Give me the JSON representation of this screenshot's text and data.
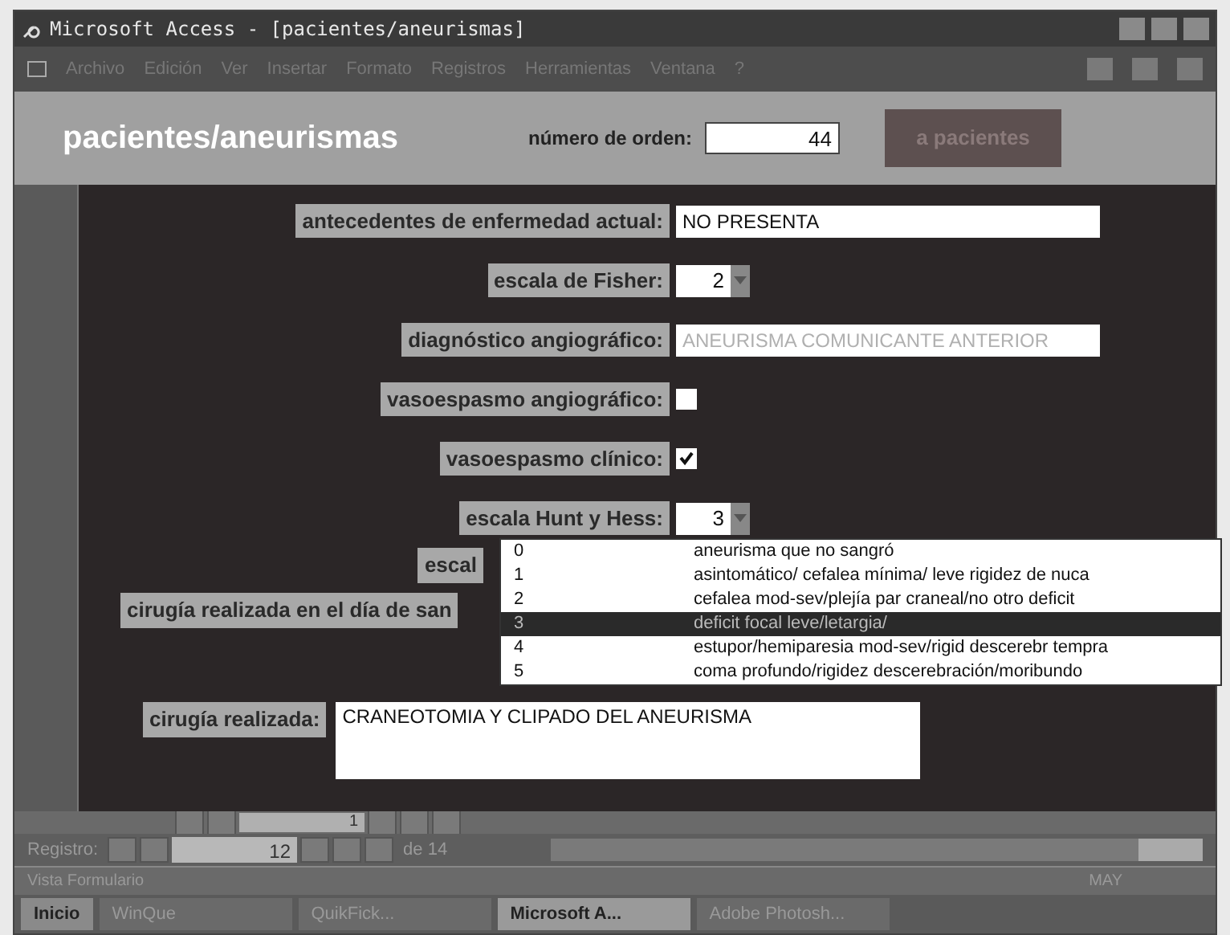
{
  "window": {
    "title": "Microsoft Access - [pacientes/aneurismas]"
  },
  "menu": [
    "Archivo",
    "Edición",
    "Ver",
    "Insertar",
    "Formato",
    "Registros",
    "Herramientas",
    "Ventana",
    "?"
  ],
  "form": {
    "title": "pacientes/aneurismas",
    "order_label": "número de orden:",
    "order_value": "44",
    "button": "a pacientes"
  },
  "fields": [
    {
      "kind": "text",
      "label": "antecedentes de enfermedad actual:",
      "value": "NO PRESENTA",
      "dim": false
    },
    {
      "kind": "combo",
      "label": "escala de Fisher:",
      "value": "2"
    },
    {
      "kind": "text",
      "label": "diagnóstico angiográfico:",
      "value": "ANEURISMA COMUNICANTE ANTERIOR",
      "dim": true
    },
    {
      "kind": "check",
      "label": "vasoespasmo angiográfico:",
      "checked": false
    },
    {
      "kind": "check",
      "label": "vasoespasmo clínico:",
      "checked": true
    },
    {
      "kind": "combo",
      "label": "escala Hunt y Hess:",
      "value": "3"
    },
    {
      "kind": "hidden",
      "label": "escal"
    },
    {
      "kind": "hidden",
      "label": "cirugía realizada en el día de san"
    }
  ],
  "dropdown": [
    {
      "code": "0",
      "text": "aneurisma que no sangró",
      "selected": false
    },
    {
      "code": "1",
      "text": "asintomático/ cefalea mínima/ leve rigidez de nuca",
      "selected": false
    },
    {
      "code": "2",
      "text": "cefalea mod-sev/plejía par craneal/no otro deficit",
      "selected": false
    },
    {
      "code": "3",
      "text": "deficit focal leve/letargia/",
      "selected": true
    },
    {
      "code": "4",
      "text": "estupor/hemiparesia mod-sev/rigid descerebr tempra",
      "selected": false
    },
    {
      "code": "5",
      "text": "coma profundo/rigidez descerebración/moribundo",
      "selected": false
    }
  ],
  "surgery": {
    "label": "cirugía realizada:",
    "value": "CRANEOTOMIA Y CLIPADO DEL ANEURISMA"
  },
  "subform_nav": {
    "record": "1"
  },
  "record_nav": {
    "label": "Registro:",
    "record": "12",
    "total": "de 14"
  },
  "status_bar": {
    "text": "Vista Formulario",
    "indicator": "MAY"
  },
  "taskbar": {
    "start": "Inicio",
    "tasks": [
      {
        "label": "WinQue",
        "selected": false
      },
      {
        "label": "QuikFick...",
        "selected": false
      },
      {
        "label": "Microsoft A...",
        "selected": true
      },
      {
        "label": "Adobe Photosh...",
        "selected": false
      }
    ]
  }
}
